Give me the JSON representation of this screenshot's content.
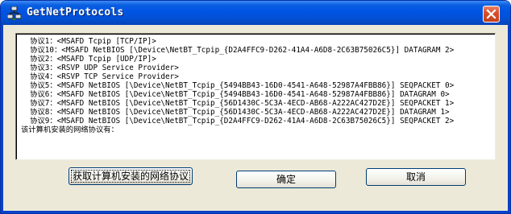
{
  "window": {
    "title": "GetNetProtocols"
  },
  "output": {
    "lines": [
      "  协议1：<MSAFD Tcpip [TCP/IP]>",
      "  协议10：<MSAFD NetBIOS [\\Device\\NetBT_Tcpip_{D2A4FFC9-D262-41A4-A6D8-2C63B75026C5}] DATAGRAM 2>",
      "  协议2：<MSAFD Tcpip [UDP/IP]>",
      "  协议3：<RSVP UDP Service Provider>",
      "  协议4：<RSVP TCP Service Provider>",
      "  协议5：<MSAFD NetBIOS [\\Device\\NetBT_Tcpip_{5494BB43-16D0-4541-A648-52987A4FBB86}] SEQPACKET 0>",
      "  协议6：<MSAFD NetBIOS [\\Device\\NetBT_Tcpip_{5494BB43-16D0-4541-A648-52987A4FBB86}] DATAGRAM 0>",
      "  协议7：<MSAFD NetBIOS [\\Device\\NetBT_Tcpip_{56D1430C-5C3A-4ECD-AB68-A222AC427D2E}] SEQPACKET 1>",
      "  协议8：<MSAFD NetBIOS [\\Device\\NetBT_Tcpip_{56D1430C-5C3A-4ECD-AB68-A222AC427D2E}] DATAGRAM 1>",
      "  协议9：<MSAFD NetBIOS [\\Device\\NetBT_Tcpip_{D2A4FFC9-D262-41A4-A6D8-2C63B75026C5}] SEQPACKET 2>",
      "该计算机安装的网络协议有："
    ]
  },
  "buttons": {
    "get_protocols": "获取计算机安装的网络协议",
    "ok": "确定",
    "cancel": "取消"
  },
  "icons": {
    "app": "network-app-icon",
    "close": "close-icon"
  },
  "colors": {
    "titlebar": "#0054e3",
    "close": "#d6502c",
    "dialog_bg": "#ece9d8"
  }
}
